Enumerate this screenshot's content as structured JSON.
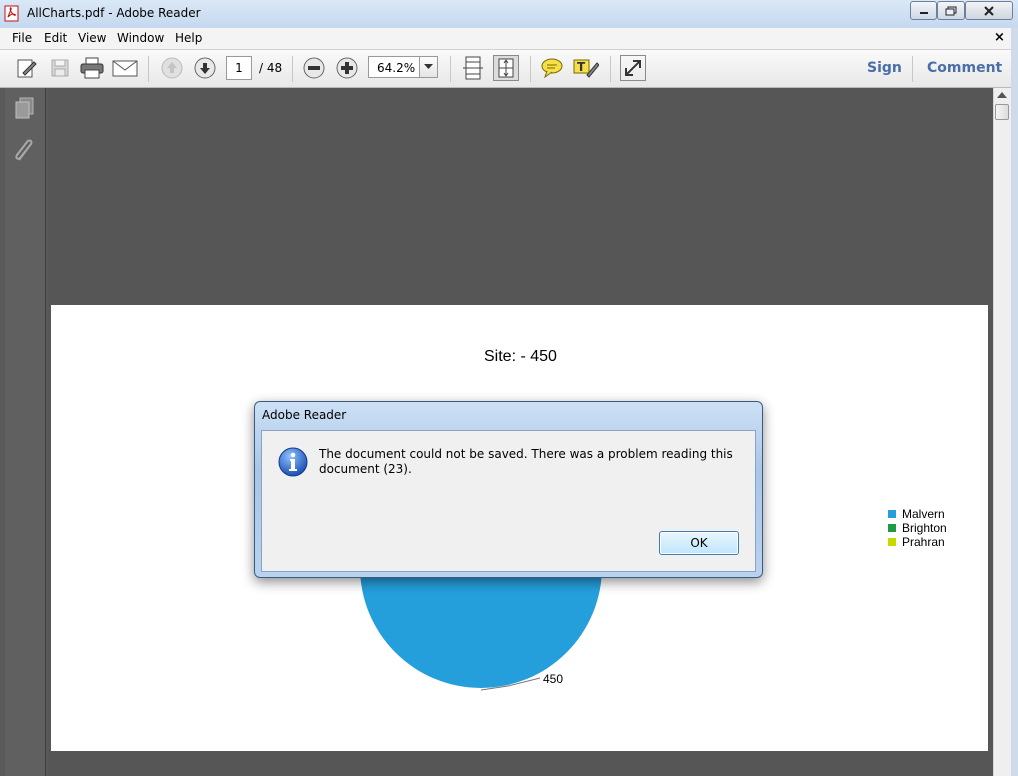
{
  "window": {
    "title": "AllCharts.pdf - Adobe Reader"
  },
  "menu": {
    "items": [
      "File",
      "Edit",
      "View",
      "Window",
      "Help"
    ],
    "close_glyph": "×"
  },
  "toolbar": {
    "current_page": "1",
    "total_pages": "/ 48",
    "zoom": "64.2%",
    "sign_label": "Sign",
    "comment_label": "Comment",
    "icons": [
      "edit-icon",
      "save-icon",
      "print-icon",
      "email-icon",
      "page-up-icon",
      "page-down-icon",
      "zoom-out-icon",
      "zoom-in-icon",
      "fit-page-icon",
      "fit-width-icon",
      "sticky-note-icon",
      "highlight-text-icon",
      "full-screen-icon"
    ]
  },
  "leftnav": {
    "icons": [
      "pages-icon",
      "attachments-icon"
    ]
  },
  "document": {
    "chart_title": "Site: - 450"
  },
  "chart_data": {
    "type": "pie",
    "title": "Site: - 450",
    "labels": [
      "Malvern",
      "Brighton",
      "Prahran"
    ],
    "values": [
      450,
      0,
      0
    ],
    "colors": [
      "#259fdc",
      "#1f9a46",
      "#c8d800"
    ],
    "data_labels": [
      "450"
    ],
    "legend": "right"
  },
  "dialog": {
    "title": "Adobe Reader",
    "message": "The document could not be saved. There was a problem reading this document (23).",
    "ok_label": "OK",
    "icon": "info-icon"
  },
  "colors": {
    "accent": "#4a6ea9",
    "doc_background": "#565656",
    "pie": "#259fdc"
  }
}
